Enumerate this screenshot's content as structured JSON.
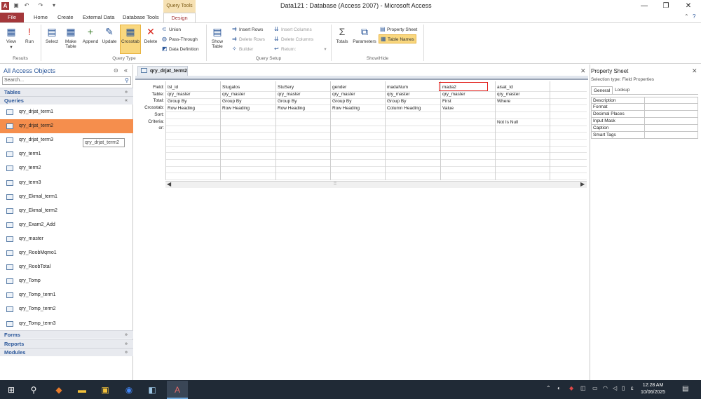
{
  "window": {
    "title": "Data121 : Database (Access 2007) - Microsoft Access",
    "context_tools": "Query Tools",
    "min": "—",
    "max": "❐",
    "close": "✕"
  },
  "tabs": {
    "file": "File",
    "home": "Home",
    "create": "Create",
    "external": "External Data",
    "dbtools": "Database Tools",
    "design": "Design"
  },
  "ribbon": {
    "results": {
      "view": "View",
      "run": "Run",
      "label": "Results"
    },
    "query_type": {
      "select": "Select",
      "make_table": "Make Table",
      "append": "Append",
      "update": "Update",
      "crosstab": "Crosstab",
      "delete": "Delete",
      "union": "Union",
      "pass_through": "Pass-Through",
      "data_definition": "Data Definition",
      "label": "Query Type"
    },
    "query_setup": {
      "show_table": "Show Table",
      "insert_rows": "Insert Rows",
      "delete_rows": "Delete Rows",
      "builder": "Builder",
      "insert_columns": "Insert Columns",
      "delete_columns": "Delete Columns",
      "return": "Return:",
      "label": "Query Setup"
    },
    "show_hide": {
      "totals": "Totals",
      "parameters": "Parameters",
      "property_sheet": "Property Sheet",
      "table_names": "Table Names",
      "label": "Show/Hide"
    }
  },
  "nav": {
    "title": "All Access Objects",
    "search_placeholder": "Search...",
    "categories": {
      "tables": "Tables",
      "queries": "Queries",
      "forms": "Forms",
      "reports": "Reports",
      "modules": "Modules"
    },
    "queries": [
      "qry_drjat_term1",
      "qry_drjat_term2",
      "qry_drjat_term3",
      "qry_term1",
      "qry_term2",
      "qry_term3",
      "qry_Ekmal_term1",
      "qry_Ekmal_term2",
      "qry_Exam2_Add",
      "qry_master",
      "qry_RoobMqmo1",
      "qry_RoobTotal",
      "qry_Tomp",
      "qry_Tomp_term1",
      "qry_Tomp_term2",
      "qry_Tomp_term3"
    ],
    "selected": "qry_drjat_term2",
    "tooltip": "qry_drjat_term2"
  },
  "document": {
    "tab_title": "qry_drjat_term2",
    "row_labels": [
      "Field:",
      "Table:",
      "Total:",
      "Crosstab:",
      "Sort:",
      "Criteria:",
      "or:"
    ],
    "columns": [
      {
        "field": "tsl_id",
        "table": "qry_master",
        "total": "Group By",
        "crosstab": "Row Heading",
        "criteria": ""
      },
      {
        "field": "Stugalos",
        "table": "qry_master",
        "total": "Group By",
        "crosstab": "Row Heading",
        "criteria": ""
      },
      {
        "field": "StuSery",
        "table": "qry_master",
        "total": "Group By",
        "crosstab": "Row Heading",
        "criteria": ""
      },
      {
        "field": "gender",
        "table": "qry_master",
        "total": "Group By",
        "crosstab": "Row Heading",
        "criteria": ""
      },
      {
        "field": "madaNum",
        "table": "qry_master",
        "total": "Group By",
        "crosstab": "Column Heading",
        "criteria": ""
      },
      {
        "field": "mada2",
        "table": "qry_master",
        "total": "First",
        "crosstab": "Value",
        "criteria": ""
      },
      {
        "field": "aisat_Id",
        "table": "qry_master",
        "total": "Where",
        "crosstab": "",
        "criteria": "Not Is Null"
      }
    ]
  },
  "property_sheet": {
    "title": "Property Sheet",
    "selection_type": "Selection type: Field Properties",
    "tab_general": "General",
    "tab_lookup": "Lookup",
    "properties": [
      "Description",
      "Format",
      "Decimal Places",
      "Input Mask",
      "Caption",
      "Smart Tags"
    ]
  },
  "taskbar": {
    "time": "12:28 AM",
    "date": "10/06/2025",
    "lang": "ε"
  }
}
